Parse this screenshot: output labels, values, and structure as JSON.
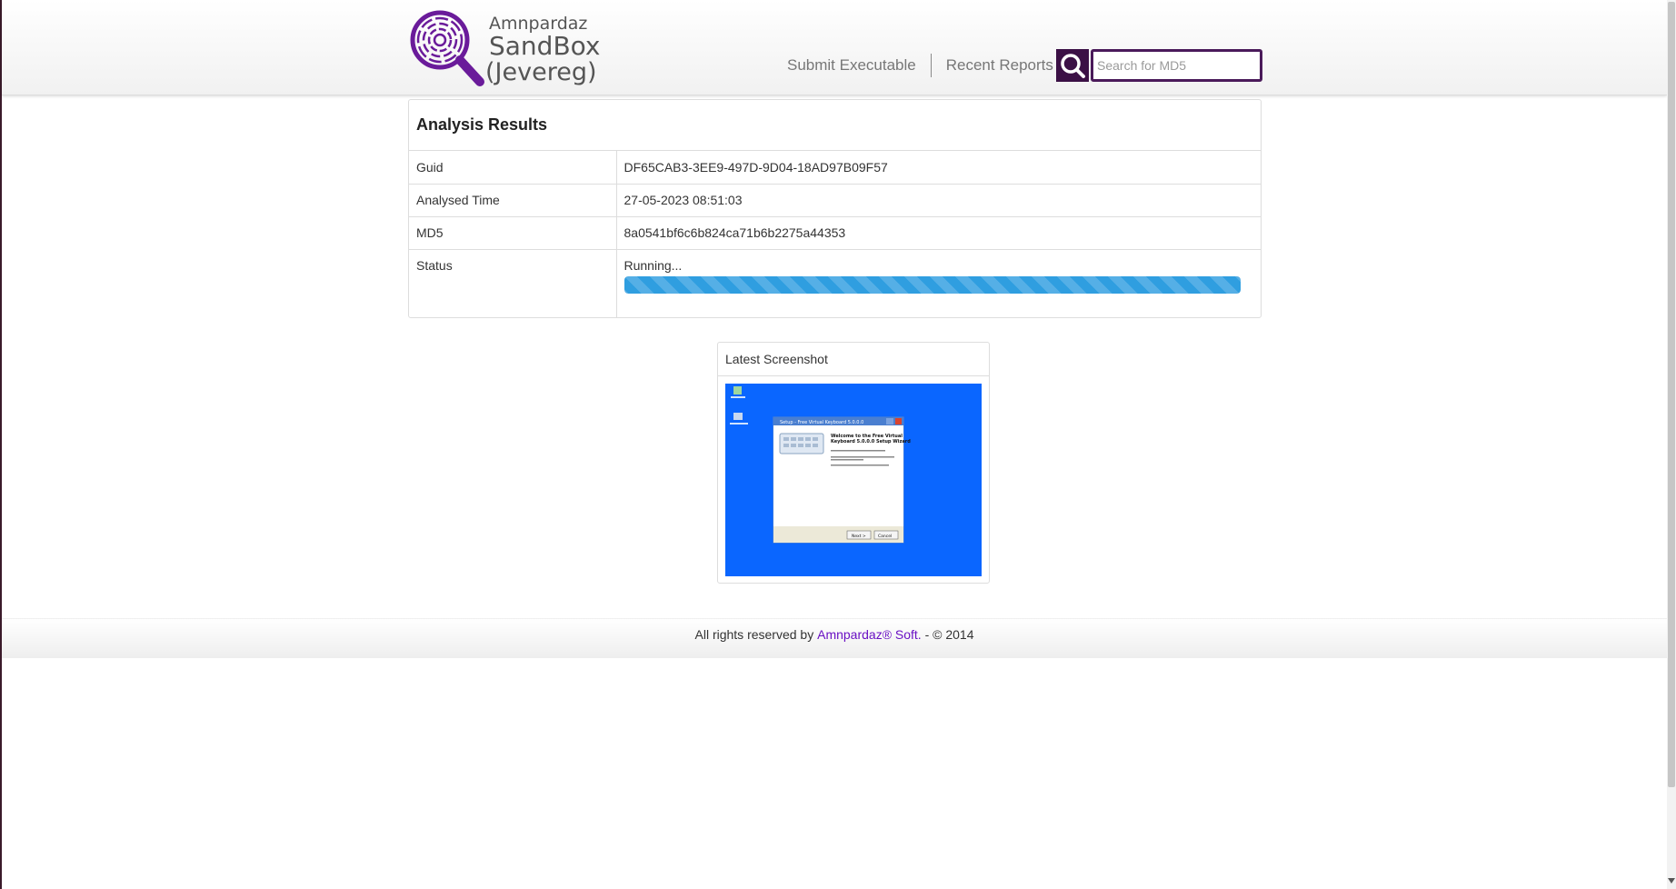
{
  "brand": {
    "line1": "Amnpardaz",
    "line2": "SandBox",
    "line3": "(Jevereg)",
    "color": "#6a1b9a"
  },
  "nav": {
    "submit_label": "Submit Executable",
    "recent_label": "Recent Reports"
  },
  "search": {
    "placeholder": "Search for MD5",
    "value": "",
    "icon": "search-icon"
  },
  "results": {
    "heading": "Analysis Results",
    "rows": [
      {
        "key": "Guid",
        "value": "DF65CAB3-3EE9-497D-9D04-18AD97B09F57"
      },
      {
        "key": "Analysed Time",
        "value": "27-05-2023 08:51:03"
      },
      {
        "key": "MD5",
        "value": "8a0541bf6c6b824ca71b6b2275a44353"
      }
    ],
    "status": {
      "key": "Status",
      "value": "Running...",
      "progress": 1.0,
      "color": "#2f9ee0"
    }
  },
  "screenshot": {
    "heading": "Latest Screenshot",
    "dialog_title": "Setup - Free Virtual Keyboard 5.0.0.0",
    "dialog_heading_1": "Welcome to the Free Virtual",
    "dialog_heading_2": "Keyboard 5.0.0.0 Setup Wizard",
    "next_label": "Next >",
    "cancel_label": "Cancel"
  },
  "footer": {
    "prefix": "All rights reserved by",
    "company": "Amnpardaz® Soft.",
    "suffix": "- © 2014",
    "link_color": "#6a11c4"
  }
}
